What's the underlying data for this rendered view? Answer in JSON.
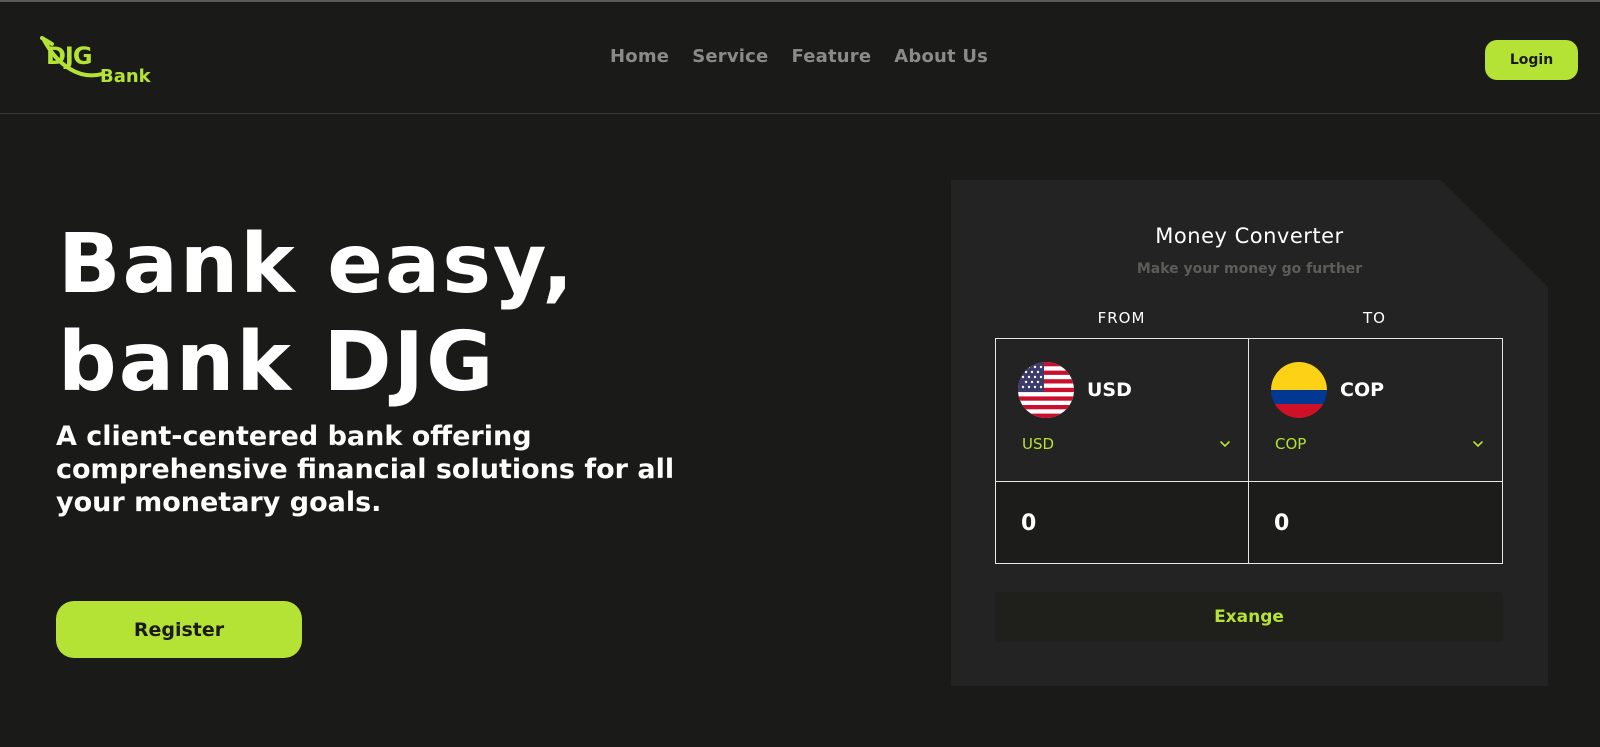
{
  "brand": {
    "logo_mark": "DJG",
    "logo_text": "Bank",
    "accent_color": "#b5e335",
    "background_color": "#1a1a18"
  },
  "nav": {
    "items": [
      {
        "label": "Home"
      },
      {
        "label": "Service"
      },
      {
        "label": "Feature"
      },
      {
        "label": "About Us"
      }
    ]
  },
  "header": {
    "login_label": "Login"
  },
  "hero": {
    "title_line1": "Bank easy,",
    "title_line2": "bank DJG",
    "subtitle": "A client-centered bank offering comprehensive financial solutions for all your monetary goals.",
    "register_label": "Register"
  },
  "converter": {
    "title": "Money Converter",
    "subtitle": "Make your money go further",
    "from_label": "FROM",
    "to_label": "TO",
    "from": {
      "code": "USD",
      "selected": "USD",
      "amount": "0",
      "flag_icon": "us-flag-icon"
    },
    "to": {
      "code": "COP",
      "selected": "COP",
      "amount": "0",
      "flag_icon": "colombia-flag-icon"
    },
    "exchange_label": "Exange"
  }
}
